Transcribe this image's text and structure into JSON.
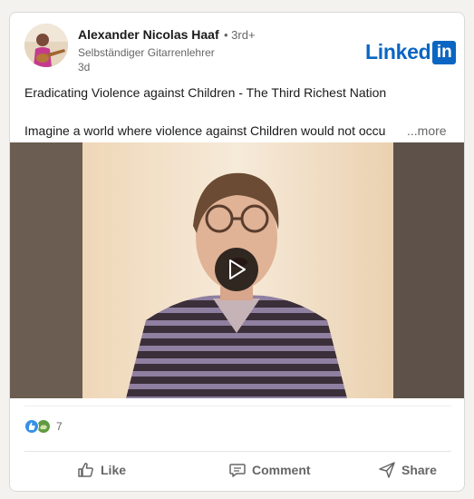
{
  "post": {
    "author": "Alexander Nicolas Haaf",
    "degree": "• 3rd+",
    "headline": "Selbständiger Gitarrenlehrer",
    "timestamp": "3d",
    "title": "Eradicating Violence against Children - The Third Richest Nation",
    "body": "Imagine a world where violence against Children would not occu",
    "more_label": "...more"
  },
  "brand": {
    "text": "Linked",
    "box": "in",
    "color": "#0a66c2"
  },
  "media": {
    "type": "video",
    "play_icon": "play-icon"
  },
  "reactions": {
    "icons": [
      "like-reaction-icon",
      "support-reaction-icon"
    ],
    "count": "7"
  },
  "actions": [
    {
      "label": "Like",
      "icon": "thumbs-up-icon"
    },
    {
      "label": "Comment",
      "icon": "comment-icon"
    },
    {
      "label": "Share",
      "icon": "send-icon"
    }
  ]
}
